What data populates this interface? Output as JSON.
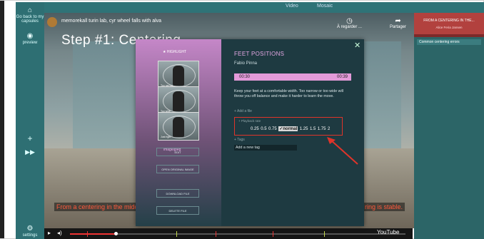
{
  "sidebar": {
    "home_label": "Go back to my capsules",
    "preview_label": "preview",
    "settings_label": "settings"
  },
  "topbar": {
    "tabs": [
      {
        "label": "Video"
      },
      {
        "label": "Mosaic"
      }
    ]
  },
  "video": {
    "title": "memorekall turin lab, cyr wheel falls with alva",
    "overlay_text": "Step #1: Centering",
    "watch_later_label": "À regarder ...",
    "share_label": "Partager",
    "subtitle_left": "From a centering in the midd",
    "subtitle_right": "ring is stable.",
    "youtube_label": "YouTube"
  },
  "right_panel": {
    "header": "FROM A CENTERING IN THE...",
    "header_sub": "Alice Feria Jansen",
    "selected_item": "Common centering errors"
  },
  "modal": {
    "highlight_label": "★ HIGHLIGHT",
    "thumbs": [
      {
        "caption": "Too narrow"
      },
      {
        "caption": "Too wide"
      },
      {
        "caption": "Just right"
      }
    ],
    "mime": "image/jpeg",
    "edit_label": "EDIT",
    "open_original_label": "OPEN ORIGINAL IMAGE",
    "download_label": "DOWNLOAD FILE",
    "delete_label": "DELETE FILE",
    "title": "FEET POSITIONS",
    "author": "Fabio Pinna",
    "time_start": "00:30",
    "time_end": "00:39",
    "description": "Keep your feet at a comfortable width. Too narrow or too wide will throw you off balance and make it harder to learn the move.",
    "add_file_label": "+ Add a file",
    "playback_label": "+ Playback rate",
    "rates": [
      "0.25",
      "0.5",
      "0.75",
      "✓normal",
      "1.25",
      "1.5",
      "1.75",
      "2"
    ],
    "selected_rate": "✓normal",
    "tags_label": "+ Tags",
    "tag_placeholder": "Add a new tag"
  },
  "colors": {
    "accent_pink": "#e39ad9",
    "highlight_red": "#e0342a",
    "teal": "#2e6f73"
  }
}
